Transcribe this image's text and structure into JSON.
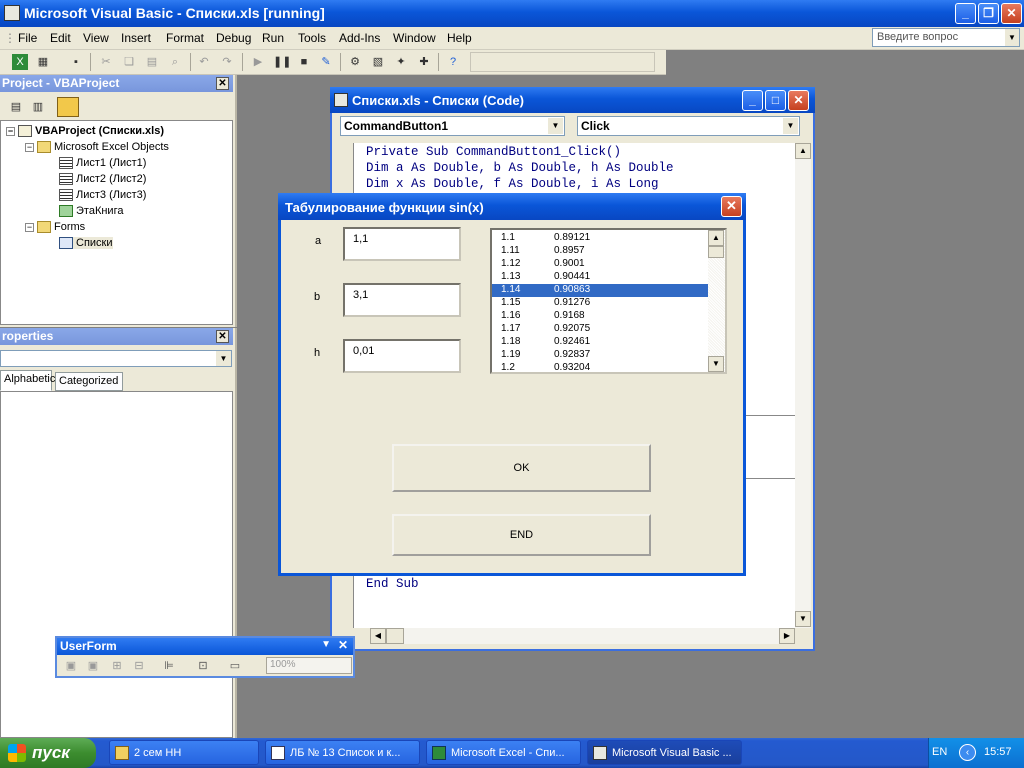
{
  "app": {
    "title": "Microsoft Visual Basic - Списки.xls [running]"
  },
  "menu": [
    "File",
    "Edit",
    "View",
    "Insert",
    "Format",
    "Debug",
    "Run",
    "Tools",
    "Add-Ins",
    "Window",
    "Help"
  ],
  "ask_placeholder": "Введите вопрос",
  "project": {
    "title": "Project - VBAProject",
    "root": "VBAProject (Списки.xls)",
    "excel_objects": "Microsoft Excel Objects",
    "sheets": [
      "Лист1 (Лист1)",
      "Лист2 (Лист2)",
      "Лист3 (Лист3)"
    ],
    "workbook": "ЭтаКнига",
    "forms_folder": "Forms",
    "form": "Списки"
  },
  "properties": {
    "title": "roperties",
    "tabs": [
      "Alphabetic",
      "Categorized"
    ]
  },
  "code_window": {
    "title": "Списки.xls - Списки (Code)",
    "object_combo": "CommandButton1",
    "proc_combo": "Click",
    "lines": [
      "Private Sub CommandButton1_Click()",
      "Dim a As Double, b As Double, h As Double",
      "Dim x As Double, f As Double, i As Long"
    ],
    "end_line": "End Sub"
  },
  "dialog": {
    "title": "Табулирование функции sin(x)",
    "labels": {
      "a": "a",
      "b": "b",
      "h": "h"
    },
    "values": {
      "a": "1,1",
      "b": "3,1",
      "h": "0,01"
    },
    "list": [
      [
        "1.1",
        "0.89121"
      ],
      [
        "1.11",
        "0.8957"
      ],
      [
        "1.12",
        "0.9001"
      ],
      [
        "1.13",
        "0.90441"
      ],
      [
        "1.14",
        "0.90863"
      ],
      [
        "1.15",
        "0.91276"
      ],
      [
        "1.16",
        "0.9168"
      ],
      [
        "1.17",
        "0.92075"
      ],
      [
        "1.18",
        "0.92461"
      ],
      [
        "1.19",
        "0.92837"
      ],
      [
        "1.2",
        "0.93204"
      ]
    ],
    "selected_index": 4,
    "ok_label": "OK",
    "end_label": "END"
  },
  "userform_toolbar": {
    "title": "UserForm",
    "zoom": "100%"
  },
  "taskbar": {
    "start": "пуск",
    "tasks": [
      "2 сем НН",
      "ЛБ № 13 Список и к...",
      "Microsoft Excel - Спи...",
      "Microsoft Visual Basic ..."
    ],
    "lang": "EN",
    "clock": "15:57"
  }
}
